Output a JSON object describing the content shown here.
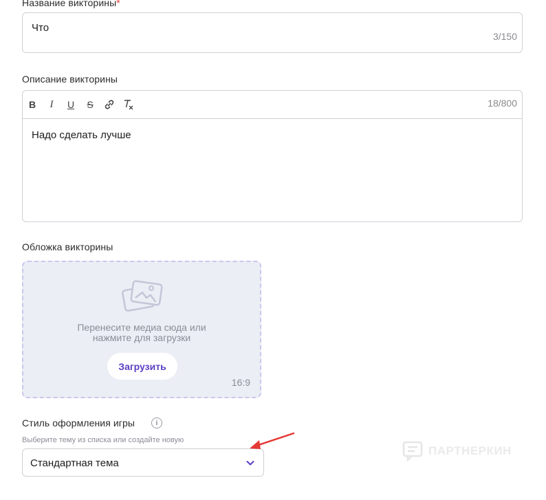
{
  "quiz_title": {
    "label": "Название викторины",
    "required_mark": "*",
    "value": "Что",
    "counter": "3/150"
  },
  "quiz_description": {
    "label": "Описание викторины",
    "counter": "18/800",
    "value": "Надо сделать лучше",
    "toolbar": {
      "bold": "B",
      "italic": "I",
      "underline": "U",
      "strike": "S",
      "link": "link-icon",
      "clear_format": "clear-format-icon"
    }
  },
  "quiz_cover": {
    "label": "Обложка викторины",
    "dropzone_text_line1": "Перенесите медиа сюда или",
    "dropzone_text_line2": "нажмите для загрузки",
    "upload_button": "Загрузить",
    "aspect_ratio": "16:9",
    "icon": "image-upload-icon"
  },
  "game_style": {
    "label": "Стиль оформления игры",
    "hint": "Выберите тему из списка или создайте новую",
    "selected": "Стандартная тема",
    "info_icon": "i"
  },
  "watermark": {
    "text": "ПАРТНЕРКИН"
  },
  "colors": {
    "accent": "#5b3fc4",
    "required": "#e53935",
    "annotation_arrow": "#e53935",
    "dropzone_bg": "#eceef5",
    "dropzone_border": "#c9c7ef"
  }
}
